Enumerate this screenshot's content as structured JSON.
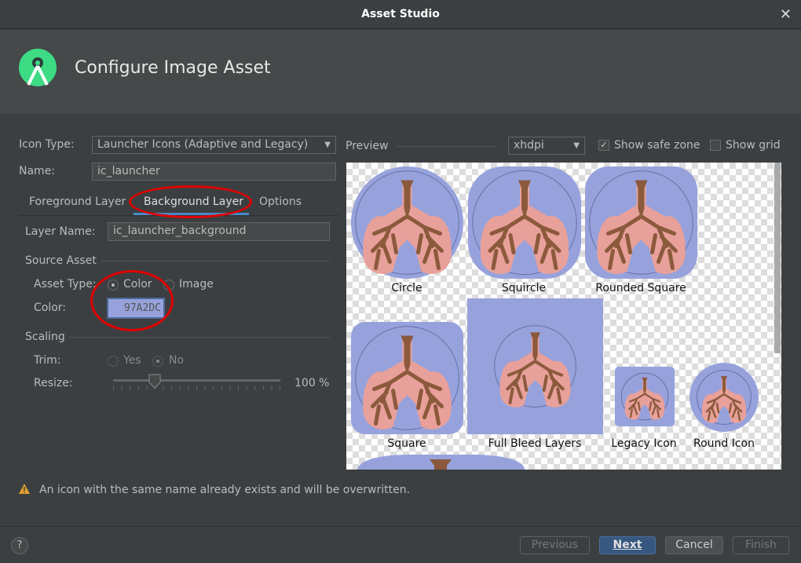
{
  "window": {
    "title": "Asset Studio",
    "close_icon": "close-icon"
  },
  "header": {
    "title": "Configure Image Asset",
    "logo": "android-studio-logo"
  },
  "form": {
    "icon_type_label": "Icon Type:",
    "icon_type_value": "Launcher Icons (Adaptive and Legacy)",
    "name_label": "Name:",
    "name_value": "ic_launcher",
    "tabs": [
      {
        "label": "Foreground Layer",
        "active": false
      },
      {
        "label": "Background Layer",
        "active": true
      },
      {
        "label": "Options",
        "active": false
      }
    ],
    "layer_name_label": "Layer Name:",
    "layer_name_value": "ic_launcher_background",
    "source_asset_title": "Source Asset",
    "asset_type_label": "Asset Type:",
    "asset_type_options": [
      "Color",
      "Image"
    ],
    "asset_type_selected": "Color",
    "color_label": "Color:",
    "color_value": "97A2DC",
    "color_swatch": "#97a2dc",
    "scaling_title": "Scaling",
    "trim_label": "Trim:",
    "trim_options": [
      "Yes",
      "No"
    ],
    "trim_selected": "No",
    "resize_label": "Resize:",
    "resize_value": "100 %",
    "resize_percent": 100
  },
  "preview": {
    "label": "Preview",
    "density": "xhdpi",
    "show_safe_zone_label": "Show safe zone",
    "show_safe_zone": true,
    "show_grid_label": "Show grid",
    "show_grid": false,
    "icons": [
      "Circle",
      "Squircle",
      "Rounded Square",
      "Square",
      "Full Bleed Layers",
      "Legacy Icon",
      "Round Icon"
    ]
  },
  "warning": {
    "text": "An icon with the same name already exists and will be overwritten.",
    "icon": "warning-icon"
  },
  "footer": {
    "help": "?",
    "previous": "Previous",
    "next": "Next",
    "cancel": "Cancel",
    "finish": "Finish"
  },
  "colors": {
    "accent": "#4a88c7",
    "annotation": "#e00000",
    "icon_bg": "#97a2dc",
    "lungs": "#e8a09a",
    "bronchi": "#8b5a3c"
  }
}
